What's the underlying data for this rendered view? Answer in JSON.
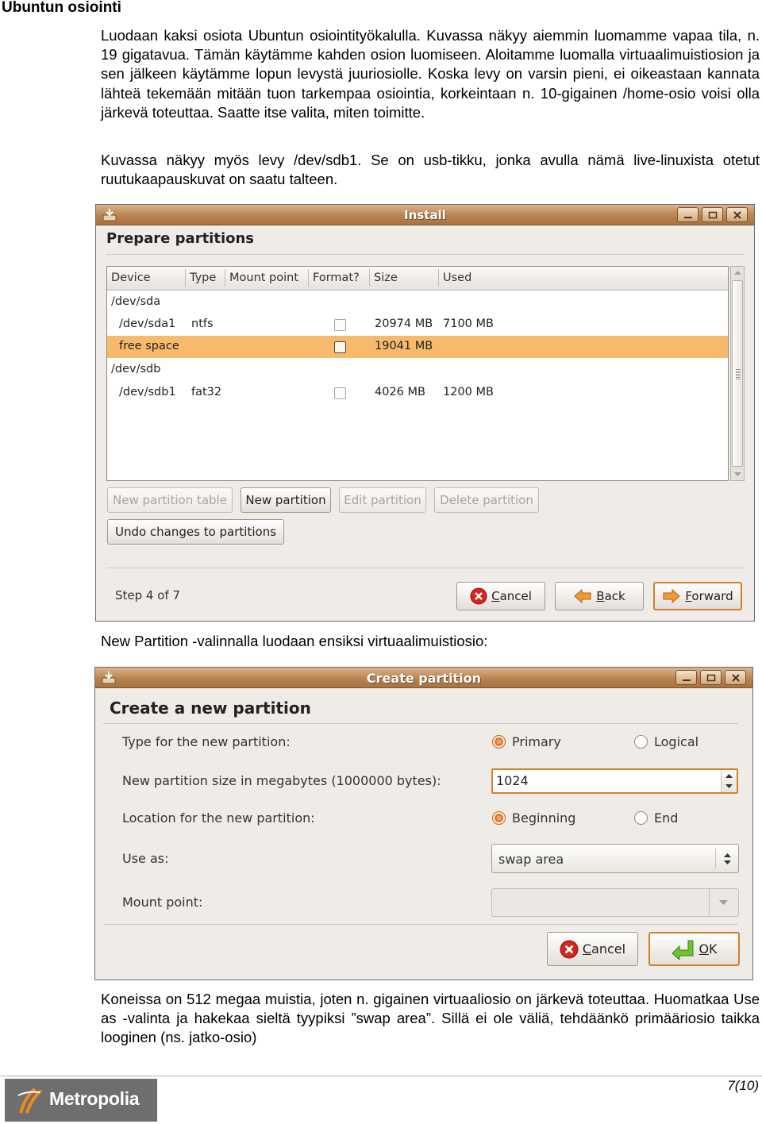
{
  "doc": {
    "title": "Ubuntun osiointi",
    "p1": "Luodaan kaksi osiota Ubuntun osiointityökalulla. Kuvassa näkyy aiemmin luomamme vapaa tila, n. 19 gigatavua. Tämän käytämme kahden osion luomiseen. Aloitamme luomalla virtuaalimuistiosion ja sen jälkeen käytämme lopun levystä juuriosiolle. Koska levy on varsin pieni, ei oikeastaan kannata lähteä tekemään mitään tuon tarkempaa osiointia, korkeintaan n. 10-gigainen /home-osio voisi olla järkevä toteuttaa. Saatte itse valita, miten toimitte.",
    "p2": "Kuvassa näkyy myös levy /dev/sdb1. Se on usb-tikku, jonka avulla nämä live-linuxista otetut ruutukaapauskuvat on saatu talteen.",
    "p3": "New Partition -valinnalla luodaan ensiksi virtuaalimuistiosio:",
    "p4": "Koneissa on 512 megaa muistia, joten n. gigainen virtuaaliosio on järkevä toteuttaa. Huomatkaa Use as -valinta ja hakekaa sieltä tyypiksi ”swap area”. Sillä ei ole väliä, tehdäänkö primääriosio taikka looginen (ns. jatko-osio)",
    "page_number": "7(10)",
    "logo_text": "Metropolia"
  },
  "install_window": {
    "title": "Install",
    "heading": "Prepare partitions",
    "columns": [
      "Device",
      "Type",
      "Mount point",
      "Format?",
      "Size",
      "Used"
    ],
    "rows": [
      {
        "device": "/dev/sda",
        "type": "",
        "mount": "",
        "format": null,
        "size": "",
        "used": ""
      },
      {
        "device": "/dev/sda1",
        "type": "ntfs",
        "mount": "",
        "format": false,
        "size": "20974 MB",
        "used": "7100 MB"
      },
      {
        "device": "free space",
        "type": "",
        "mount": "",
        "format": false,
        "size": "19041 MB",
        "used": "",
        "selected": true
      },
      {
        "device": "/dev/sdb",
        "type": "",
        "mount": "",
        "format": null,
        "size": "",
        "used": ""
      },
      {
        "device": "/dev/sdb1",
        "type": "fat32",
        "mount": "",
        "format": false,
        "size": "4026 MB",
        "used": "1200 MB"
      }
    ],
    "buttons": {
      "new_table": "New partition table",
      "new_partition": "New partition",
      "edit": "Edit partition",
      "delete": "Delete partition",
      "undo": "Undo changes to partitions"
    },
    "step": "Step 4 of 7",
    "nav": {
      "cancel_u": "C",
      "cancel_rest": "ancel",
      "back_u": "B",
      "back_rest": "ack",
      "forward_u": "F",
      "forward_rest": "orward"
    }
  },
  "create_window": {
    "title": "Create partition",
    "heading": "Create a new partition",
    "type_label": "Type for the new partition:",
    "type_options": [
      "Primary",
      "Logical"
    ],
    "type_selected": "Primary",
    "size_label": "New partition size in megabytes (1000000 bytes):",
    "size_value": "1024",
    "location_label": "Location for the new partition:",
    "location_options": [
      "Beginning",
      "End"
    ],
    "location_selected": "Beginning",
    "use_as_label": "Use as:",
    "use_as_value": "swap area",
    "mount_label": "Mount point:",
    "mount_value": "",
    "cancel_u": "C",
    "cancel_rest": "ancel",
    "ok_u": "O",
    "ok_rest": "K"
  }
}
